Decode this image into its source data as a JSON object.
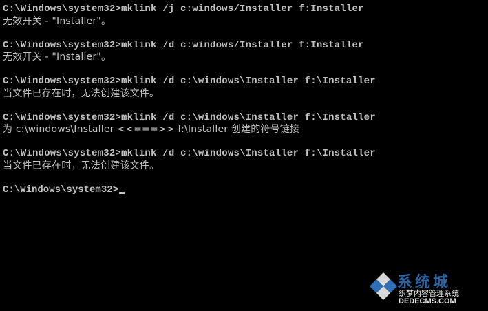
{
  "console": {
    "lines": [
      "C:\\Windows\\system32>mklink /j c:windows/Installer f:Installer",
      "无效开关 - \"Installer\"。",
      "",
      "C:\\Windows\\system32>mklink /d c:windows/Installer f:Installer",
      "无效开关 - \"Installer\"。",
      "",
      "C:\\Windows\\system32>mklink /d c:\\windows\\Installer f:\\Installer",
      "当文件已存在时，无法创建该文件。",
      "",
      "C:\\Windows\\system32>mklink /d c:\\windows\\Installer f:\\Installer",
      "为 c:\\windows\\Installer <<===>> f:\\Installer 创建的符号链接",
      "",
      "C:\\Windows\\system32>mklink /d c:\\windows\\Installer f:\\Installer",
      "当文件已存在时，无法创建该文件。",
      ""
    ],
    "prompt": "C:\\Windows\\system32>"
  },
  "watermark": {
    "title": "系统城",
    "subtitle": "织梦内容管理系统",
    "url": "DEDECMS.COM"
  },
  "colors": {
    "background": "#000000",
    "text": "#c0c0c0",
    "watermark_blue": "#2f6fb5"
  }
}
